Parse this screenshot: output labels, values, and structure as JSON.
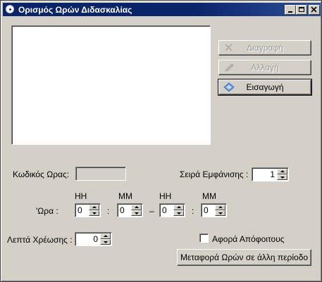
{
  "window": {
    "title": "Ορισμός Ωρών Διδασκαλίας",
    "icon": "app-icon",
    "controls": [
      "minimize-icon",
      "maximize-icon",
      "close-icon"
    ],
    "titlebar_color": "#0a246a",
    "face_color": "#d4d0c8"
  },
  "list": {
    "items": []
  },
  "buttons": {
    "delete_label": "Διαγραφή",
    "edit_label": "Αλλαγή",
    "insert_label": "Εισαγωγή",
    "transfer_label": "Μεταφορά Ωρών σε άλλη περίοδο"
  },
  "form": {
    "code_label": "Κωδικός Ωρας:",
    "code_value": "",
    "order_label": "Σειρά Εμφάνισης :",
    "order_value": "1",
    "time_label": "'Ωρα :",
    "hh1_header": "HH",
    "mm1_header": "MM",
    "hh2_header": "HH",
    "mm2_header": "MM",
    "start_hh": "0",
    "start_mm": "0",
    "end_hh": "0",
    "end_mm": "0",
    "colon1": ":",
    "dash": "–",
    "colon2": ":",
    "charge_label": "Λεπτά Χρέωσης :",
    "charge_value": "0",
    "graduates_label": "Αφορά Απόφοιτους",
    "graduates_checked": false
  }
}
